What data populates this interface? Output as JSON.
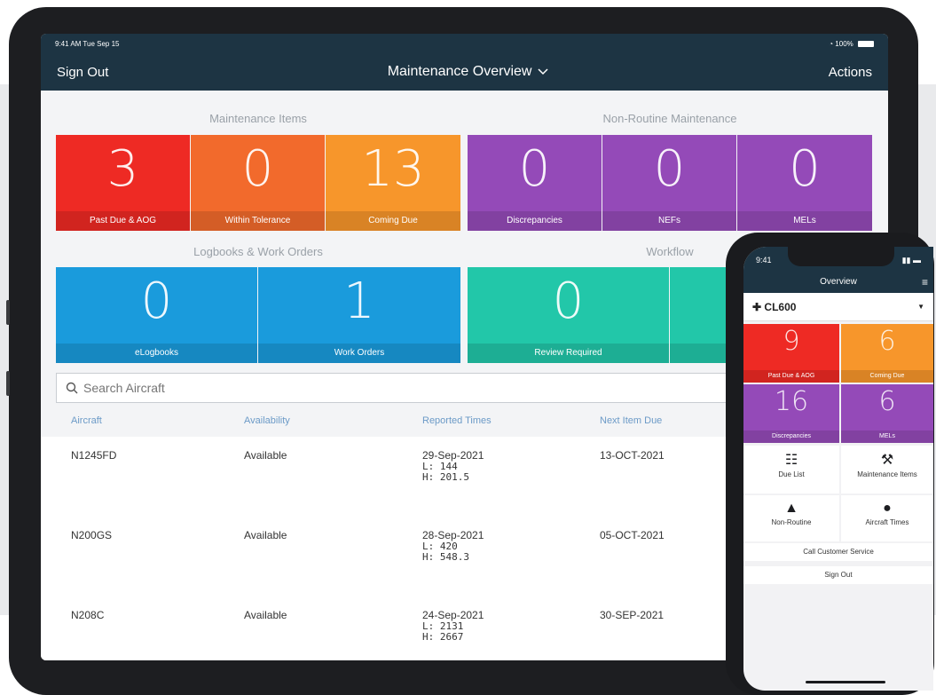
{
  "tablet": {
    "status": {
      "time": "9:41 AM  Tue Sep 15",
      "battery": "100%"
    },
    "nav": {
      "left": "Sign Out",
      "title": "Maintenance Overview",
      "right": "Actions"
    },
    "sections": {
      "maintenance": "Maintenance Items",
      "nonroutine": "Non-Routine Maintenance",
      "logbooks": "Logbooks & Work Orders",
      "workflow": "Workflow"
    },
    "tiles": [
      {
        "value": "3",
        "label": "Past Due & AOG",
        "color": "#ee2a24"
      },
      {
        "value": "0",
        "label": "Within Tolerance",
        "color": "#f26a2c"
      },
      {
        "value": "13",
        "label": "Coming Due",
        "color": "#f7962b"
      },
      {
        "value": "0",
        "label": "Discrepancies",
        "color": "#944ab8"
      },
      {
        "value": "0",
        "label": "NEFs",
        "color": "#944ab8"
      },
      {
        "value": "0",
        "label": "MELs",
        "color": "#944ab8"
      },
      {
        "value": "0",
        "label": "eLogbooks",
        "color": "#1a9bdc"
      },
      {
        "value": "1",
        "label": "Work Orders",
        "color": "#1a9bdc"
      },
      {
        "value": "0",
        "label": "Review Required",
        "color": "#22c7a9"
      },
      {
        "value": "",
        "label": "",
        "color": "#22c7a9"
      }
    ],
    "search_placeholder": "Search Aircraft",
    "columns": [
      "Aircraft",
      "Availability",
      "Reported Times",
      "Next Item Due"
    ],
    "rows": [
      {
        "aircraft": "N1245FD",
        "availability": "Available",
        "date": "29-Sep-2021",
        "l": "L: 144",
        "h": "H: 201.5",
        "next": "13-OCT-2021"
      },
      {
        "aircraft": "N200GS",
        "availability": "Available",
        "date": "28-Sep-2021",
        "l": "L: 420",
        "h": "H: 548.3",
        "next": "05-OCT-2021"
      },
      {
        "aircraft": "N208C",
        "availability": "Available",
        "date": "24-Sep-2021",
        "l": "L: 2131",
        "h": "H: 2667",
        "next": "30-SEP-2021"
      }
    ]
  },
  "phone": {
    "time": "9:41",
    "title": "Overview",
    "aircraft": "CL600",
    "tiles": [
      {
        "value": "9",
        "label": "Past Due & AOG",
        "color": "#ee2a24"
      },
      {
        "value": "6",
        "label": "Coming Due",
        "color": "#f7962b"
      },
      {
        "value": "16",
        "label": "Discrepancies",
        "color": "#944ab8"
      },
      {
        "value": "6",
        "label": "MELs",
        "color": "#944ab8"
      }
    ],
    "buttons": [
      {
        "label": "Due List",
        "icon": "list-icon"
      },
      {
        "label": "Maintenance Items",
        "icon": "tools-icon"
      },
      {
        "label": "Non-Routine",
        "icon": "warning-icon"
      },
      {
        "label": "Aircraft Times",
        "icon": "clock-icon"
      }
    ],
    "call": "Call Customer Service",
    "signout": "Sign Out"
  }
}
